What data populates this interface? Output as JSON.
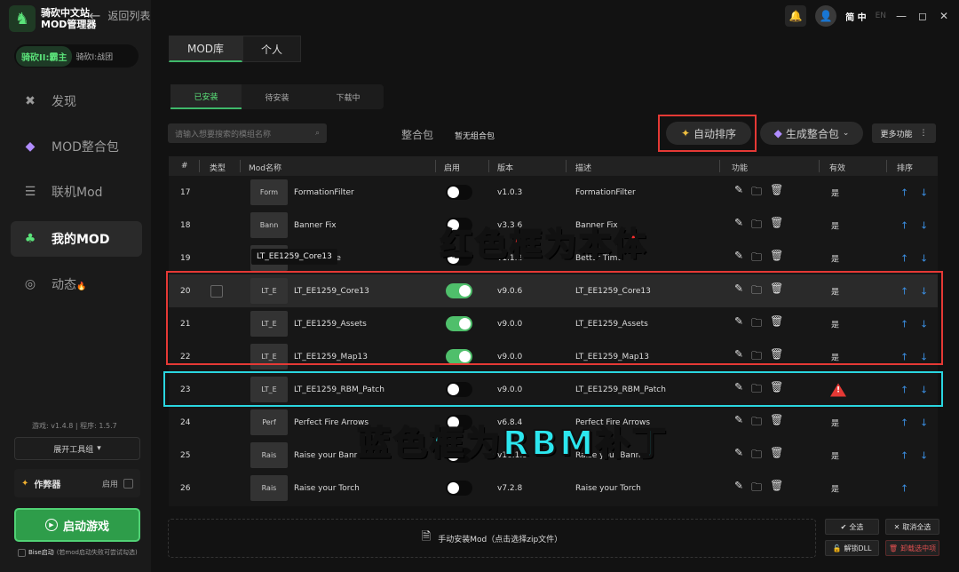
{
  "app": {
    "name_line1": "骑砍中文站",
    "name_line2": "MOD管理器",
    "back_label": "返回列表"
  },
  "game_switch": {
    "active": "骑砍II:霸主",
    "other": "骑砍I:战团"
  },
  "nav": [
    {
      "label": "发现",
      "icon": "compass-icon"
    },
    {
      "label": "MOD整合包",
      "icon": "diamond-icon"
    },
    {
      "label": "联机Mod",
      "icon": "server-icon"
    },
    {
      "label": "我的MOD",
      "icon": "leaf-icon"
    },
    {
      "label": "动态",
      "icon": "chat-icon",
      "badge": "🔥"
    }
  ],
  "version": {
    "game": "游戏: v1.4.8",
    "sep": "|",
    "program": "程序: 1.5.7"
  },
  "toolbox_label": "展开工具组",
  "author": {
    "label": "作弊器",
    "state": "启用"
  },
  "launch_label": "启动游戏",
  "bise_label": "Bise启动",
  "bise_note": "(若mod启动失败可尝试勾选)",
  "top": {
    "lang_active": "简 中",
    "lang_other": "EN"
  },
  "main_tabs": [
    "MOD库",
    "个人"
  ],
  "sub_tabs": [
    "已安装",
    "待安装",
    "下载中"
  ],
  "search_placeholder": "请输入想要搜索的模组名称",
  "pack": {
    "label": "整合包",
    "value": "暂无组合包"
  },
  "buttons": {
    "auto_sort": "自动排序",
    "gen_pack": "生成整合包",
    "more": "更多功能"
  },
  "columns": [
    "#",
    "类型",
    "Mod名称",
    "启用",
    "版本",
    "描述",
    "功能",
    "有效",
    "排序"
  ],
  "rows": [
    {
      "n": "17",
      "thumb": "Form",
      "name": "FormationFilter",
      "on": false,
      "ver": "v1.0.3",
      "desc": "FormationFilter",
      "valid": "是"
    },
    {
      "n": "18",
      "thumb": "Bann",
      "name": "Banner Fix",
      "on": false,
      "ver": "v3.3.6",
      "desc": "Banner Fix",
      "valid": "是"
    },
    {
      "n": "19",
      "thumb": "Bett",
      "name": "Better Time",
      "on": false,
      "ver": "v1.1.2",
      "desc": "Better Time",
      "valid": "是"
    },
    {
      "n": "20",
      "thumb": "LT_E",
      "name": "LT_EE1259_Core13",
      "on": true,
      "ver": "v9.0.6",
      "desc": "LT_EE1259_Core13",
      "valid": "是"
    },
    {
      "n": "21",
      "thumb": "LT_E",
      "name": "LT_EE1259_Assets",
      "on": true,
      "ver": "v9.0.0",
      "desc": "LT_EE1259_Assets",
      "valid": "是"
    },
    {
      "n": "22",
      "thumb": "LT_E",
      "name": "LT_EE1259_Map13",
      "on": true,
      "ver": "v9.0.0",
      "desc": "LT_EE1259_Map13",
      "valid": "是"
    },
    {
      "n": "23",
      "thumb": "LT_E",
      "name": "LT_EE1259_RBM_Patch",
      "on": false,
      "ver": "v9.0.0",
      "desc": "LT_EE1259_RBM_Patch",
      "valid": "!"
    },
    {
      "n": "24",
      "thumb": "Perf",
      "name": "Perfect Fire Arrows",
      "on": false,
      "ver": "v6.8.4",
      "desc": "Perfect Fire Arrows",
      "valid": "是"
    },
    {
      "n": "25",
      "thumb": "Rais",
      "name": "Raise your Banner",
      "on": false,
      "ver": "v16.1.9",
      "desc": "Raise your Banner",
      "valid": "是"
    },
    {
      "n": "26",
      "thumb": "Rais",
      "name": "Raise your Torch",
      "on": false,
      "ver": "v7.2.8",
      "desc": "Raise your Torch",
      "valid": "是"
    }
  ],
  "tooltip": "LT_EE1259_Core13",
  "overlay": {
    "red": "红色框为本体",
    "cyan": "蓝色框为RBM补丁"
  },
  "drop_label": "手动安装Mod（点击选择zip文件）",
  "bottom": {
    "select_all": "全选",
    "deselect_all": "取消全选",
    "unlock_dll": "解锁DLL",
    "uninstall": "卸载选中项"
  }
}
